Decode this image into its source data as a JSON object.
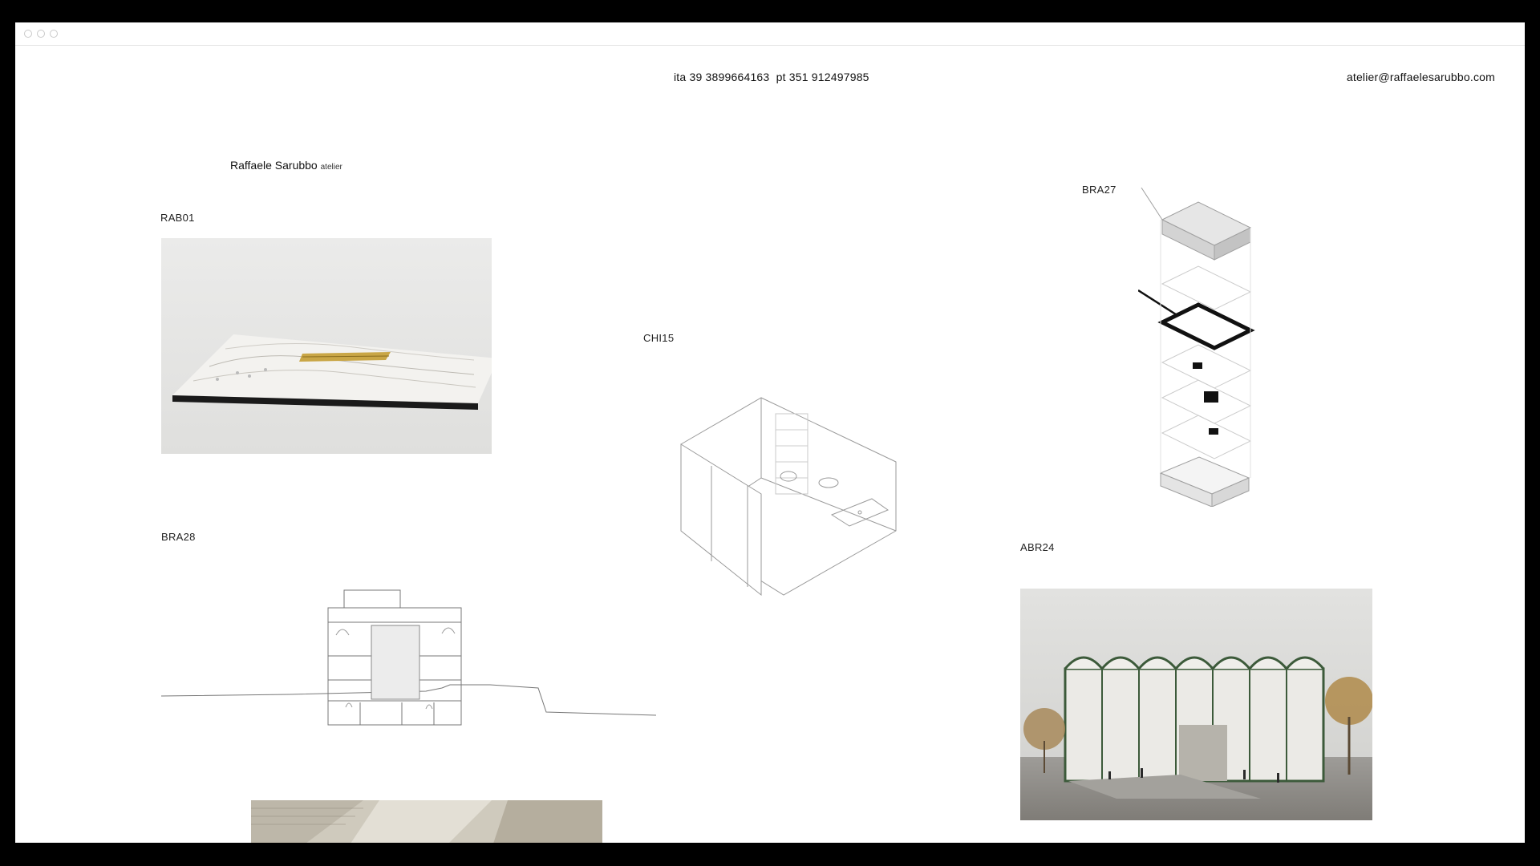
{
  "window": {
    "controls": [
      "close",
      "minimize",
      "maximize"
    ]
  },
  "header": {
    "phone": "ita 39 3899664163  pt 351 912497985",
    "email": "atelier@raffaelesarubbo.com"
  },
  "brand": {
    "name": "Raffaele Sarubbo",
    "suffix": "atelier"
  },
  "projects": [
    {
      "code": "RAB01",
      "image": "terrain-model-photo"
    },
    {
      "code": "CHI15",
      "image": "bathroom-axonometric-drawing"
    },
    {
      "code": "BRA27",
      "image": "exploded-axonometric-drawing"
    },
    {
      "code": "BRA28",
      "image": "building-section-drawing"
    },
    {
      "code": "ABR24",
      "image": "pavilion-rendering"
    },
    {
      "code": "",
      "image": "interior-canopy-photo"
    }
  ],
  "colors": {
    "frame": "#000000",
    "page": "#ffffff",
    "text": "#1a1a1a",
    "model_bg": "#e6e6e4",
    "render_sky": "#dcdcdc",
    "frame_green": "#3c5a3a"
  }
}
